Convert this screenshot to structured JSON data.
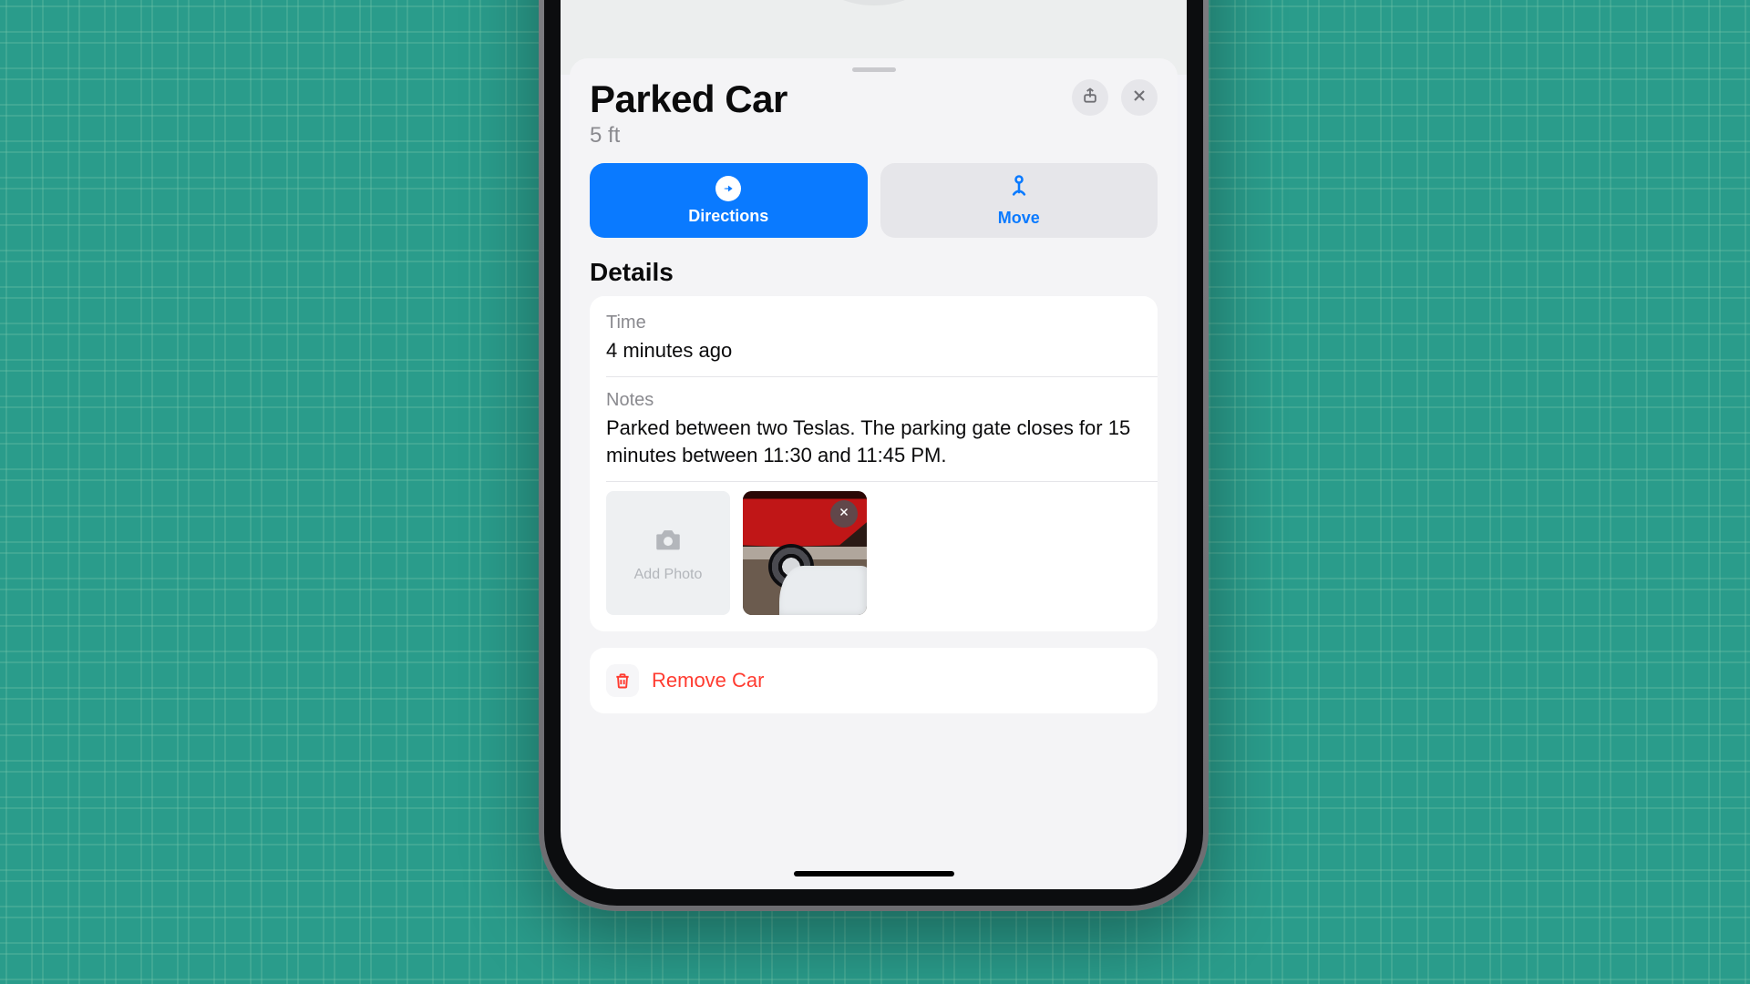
{
  "header": {
    "title": "Parked Car",
    "subtitle": "5 ft"
  },
  "actions": {
    "directions_label": "Directions",
    "move_label": "Move"
  },
  "details": {
    "section_title": "Details",
    "time": {
      "label": "Time",
      "value": "4 minutes ago"
    },
    "notes": {
      "label": "Notes",
      "value": "Parked between two Teslas. The parking gate closes for 15 minutes between 11:30 and 11:45 PM."
    },
    "add_photo_label": "Add Photo"
  },
  "remove": {
    "label": "Remove Car"
  },
  "colors": {
    "accent": "#0a7aff",
    "destructive": "#ff3b30"
  }
}
